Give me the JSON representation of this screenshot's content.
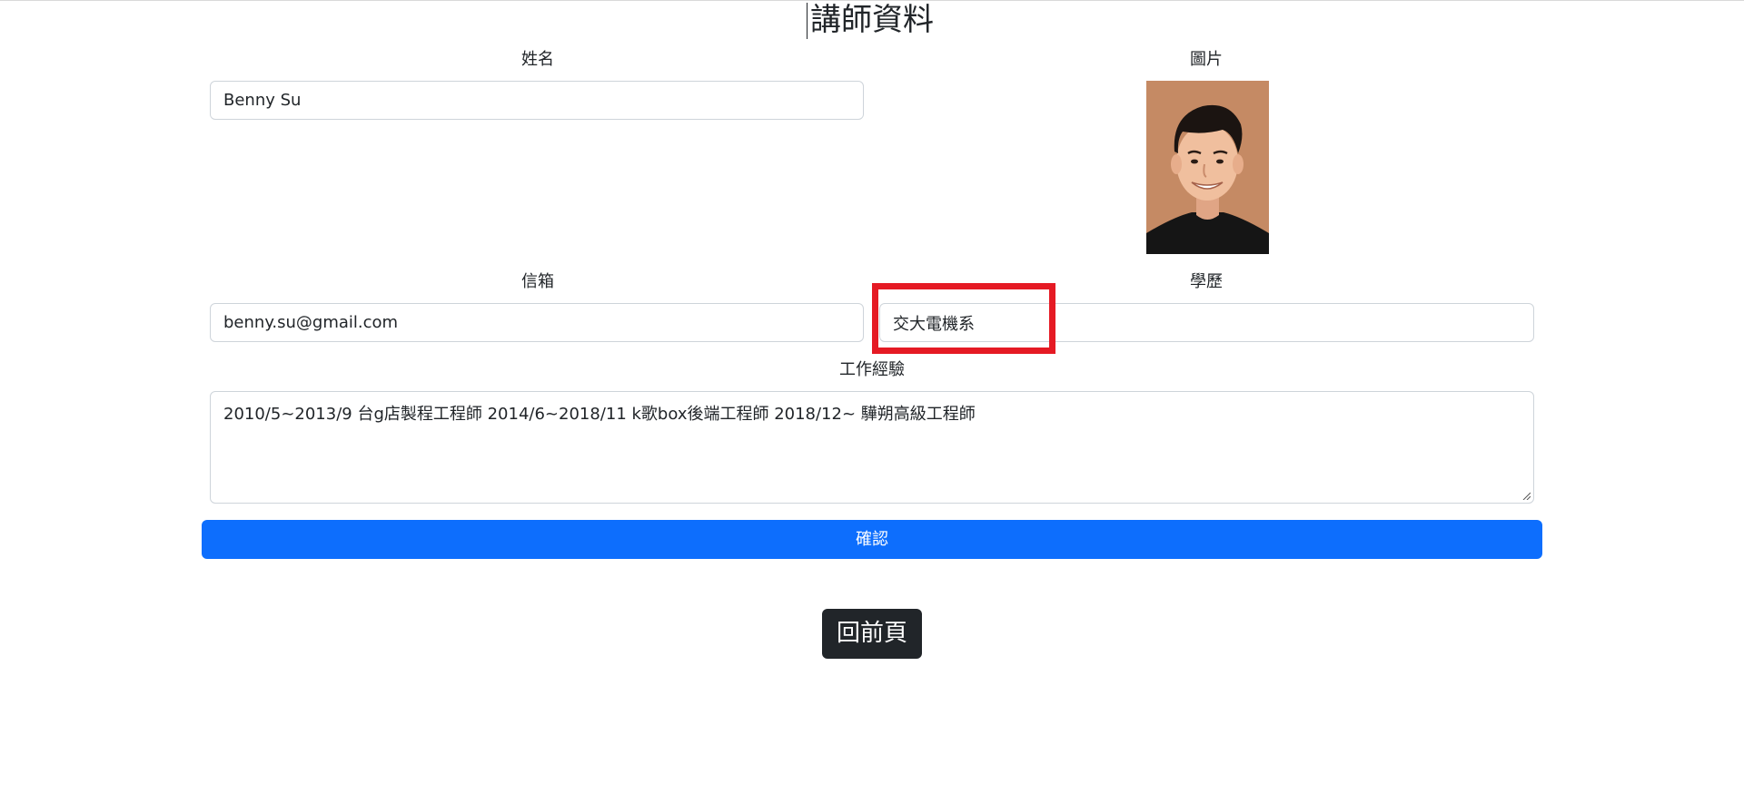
{
  "page": {
    "title": "講師資料"
  },
  "form": {
    "name": {
      "label": "姓名",
      "value": "Benny Su"
    },
    "photo": {
      "label": "圖片"
    },
    "email": {
      "label": "信箱",
      "value": "benny.su@gmail.com"
    },
    "education": {
      "label": "學歷",
      "value": "交大電機系"
    },
    "experience": {
      "label": "工作經驗",
      "value": "2010/5~2013/9 台g店製程工程師 2014/6~2018/11 k歌box後端工程師 2018/12~ 驊朔高級工程師"
    },
    "confirm_label": "確認"
  },
  "nav": {
    "back_label": "回前頁"
  },
  "colors": {
    "primary": "#0d6efd",
    "dark": "#212529",
    "highlight": "#e51a24",
    "photo_background": "#c58a64"
  }
}
